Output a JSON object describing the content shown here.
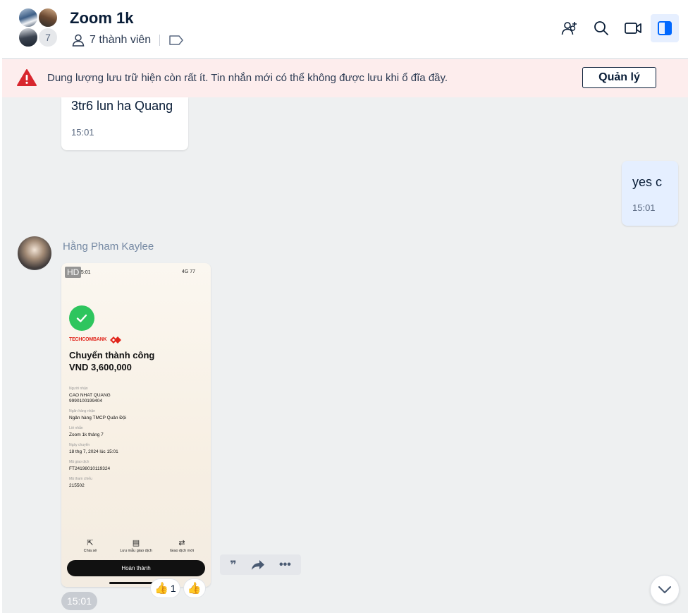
{
  "header": {
    "title": "Zoom 1k",
    "members_label": "7 thành viên",
    "member_overflow_count": "7",
    "icons": [
      "add-member-icon",
      "search-icon",
      "video-call-icon",
      "sidebar-toggle-icon"
    ]
  },
  "warning": {
    "text": "Dung lượng lưu trữ hiện còn rất ít. Tin nhắn mới có thể không được lưu khi ổ đĩa đầy.",
    "button_label": "Quản lý"
  },
  "messages": {
    "m1": {
      "text": "3tr6 lun ha Quang",
      "time": "15:01"
    },
    "m2": {
      "text": "yes c",
      "time": "15:01"
    },
    "m3": {
      "sender": "Hằng Pham Kaylee",
      "time": "15:01",
      "hd_label": "HD",
      "reactions": {
        "count": "1"
      }
    }
  },
  "receipt": {
    "status_time": "15:01",
    "status_right": "4G 77",
    "bank": "TECHCOMBANK",
    "title": "Chuyển thành công",
    "amount": "VND 3,600,000",
    "fields": [
      {
        "label": "Người nhận",
        "value": "CAO NHAT QUANG",
        "value2": "9990100199404"
      },
      {
        "label": "Ngân hàng nhận",
        "value": "Ngân hàng TMCP Quân Đội"
      },
      {
        "label": "Lời nhắn",
        "value": "Zoom 1k tháng 7"
      },
      {
        "label": "Ngày chuyển",
        "value": "18 thg 7, 2024 lúc 15:01"
      },
      {
        "label": "Mã giao dịch",
        "value": "FT24198010119324"
      },
      {
        "label": "Mã tham chiếu",
        "value": "215502"
      }
    ],
    "actions": [
      "Chia sẻ",
      "Lưu mẫu giao dịch",
      "Giao dịch mới"
    ],
    "done_label": "Hoàn thành"
  },
  "colors": {
    "accent": "#0068ff",
    "warning_bg": "#fdeded",
    "warning_icon": "#d8262e",
    "sent_bubble": "#e5efff"
  }
}
